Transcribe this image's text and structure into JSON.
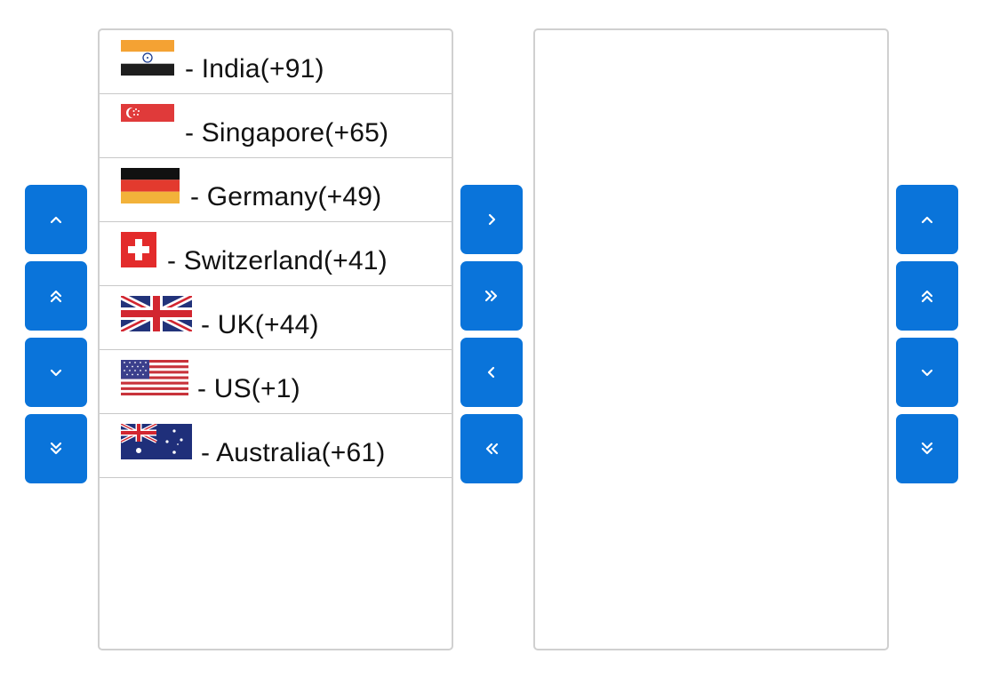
{
  "source_list": {
    "items": [
      {
        "flag": "india-flag-icon",
        "label": "- India(+91)"
      },
      {
        "flag": "singapore-flag-icon",
        "label": "- Singapore(+65)"
      },
      {
        "flag": "germany-flag-icon",
        "label": "- Germany(+49)"
      },
      {
        "flag": "switzerland-flag-icon",
        "label": "- Switzerland(+41)"
      },
      {
        "flag": "uk-flag-icon",
        "label": "- UK(+44)"
      },
      {
        "flag": "us-flag-icon",
        "label": "- US(+1)"
      },
      {
        "flag": "australia-flag-icon",
        "label": "- Australia(+61)"
      }
    ]
  },
  "target_list": {
    "items": []
  },
  "buttons": {
    "left_group": [
      "chevron-up-icon",
      "double-chevron-up-icon",
      "chevron-down-icon",
      "double-chevron-down-icon"
    ],
    "transfer_group": [
      "chevron-right-icon",
      "double-chevron-right-icon",
      "chevron-left-icon",
      "double-chevron-left-icon"
    ],
    "right_group": [
      "chevron-up-icon",
      "double-chevron-up-icon",
      "chevron-down-icon",
      "double-chevron-down-icon"
    ]
  },
  "colors": {
    "button_bg": "#0a74da",
    "button_icon": "#ffffff",
    "list_border": "#d0d0d0",
    "divider": "#c8c8c8"
  }
}
